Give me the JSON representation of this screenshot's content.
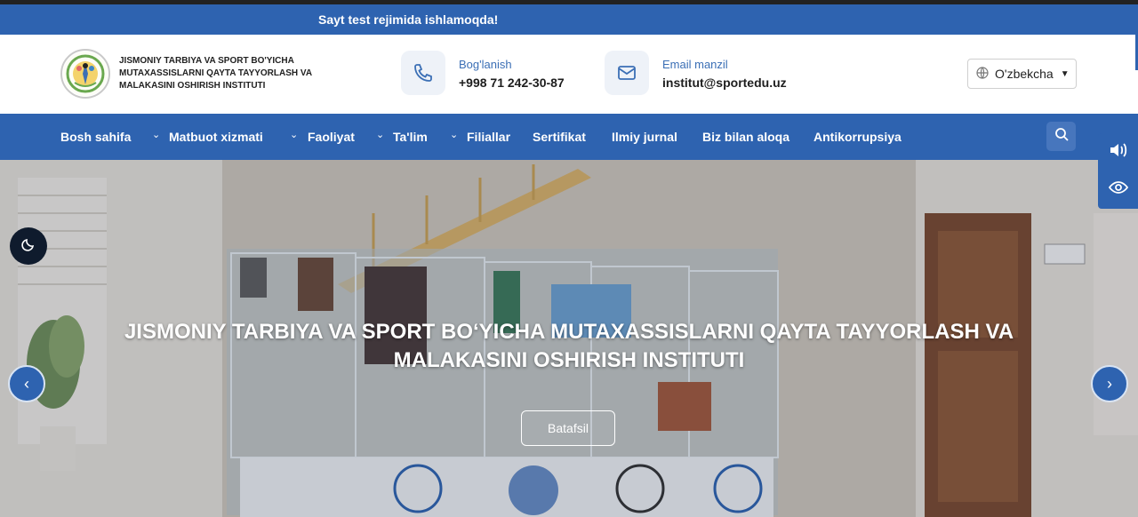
{
  "notice": {
    "text": "Sayt test rejimida ishlamoqda!"
  },
  "header": {
    "logo_title": "JISMONIY TARBIYA VA SPORT BO'YICHA MUTAXASSISLARNI QAYTA TAYYORLASH VA MALAKASINI OSHIRISH INSTITUTI",
    "contacts": [
      {
        "label": "Bog'lanish",
        "value": "+998 71 242-30-87",
        "icon": "phone-icon"
      },
      {
        "label": "Email manzil",
        "value": "institut@sportedu.uz",
        "icon": "mail-icon"
      }
    ],
    "language": {
      "selected": "O'zbekcha",
      "icon": "globe-icon"
    }
  },
  "nav": {
    "items": [
      {
        "label": "Bosh sahifa",
        "dropdown": false
      },
      {
        "label": "Matbuot xizmati",
        "dropdown": true
      },
      {
        "label": "Faoliyat",
        "dropdown": true
      },
      {
        "label": "Ta'lim",
        "dropdown": true
      },
      {
        "label": "Filiallar",
        "dropdown": true
      },
      {
        "label": "Sertifikat",
        "dropdown": false
      },
      {
        "label": "Ilmiy jurnal",
        "dropdown": false
      },
      {
        "label": "Biz bilan aloqa",
        "dropdown": false
      },
      {
        "label": "Antikorrupsiya",
        "dropdown": false
      }
    ],
    "search_icon": "search-icon"
  },
  "hero": {
    "title": "JISMONIY TARBIYA VA SPORT BO‘YICHA MUTAXASSISLARNI QAYTA TAYYORLASH VA MALAKASINI OSHIRISH INSTITUTI",
    "button": "Batafsil"
  },
  "colors": {
    "primary": "#2e63b0",
    "dark": "#0f1b2d",
    "link_label": "#3b6fb5"
  }
}
